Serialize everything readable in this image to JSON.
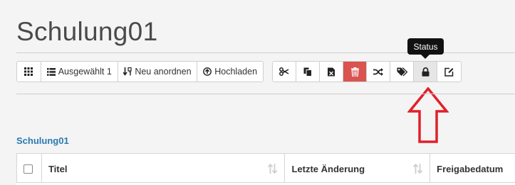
{
  "page": {
    "title": "Schulung01"
  },
  "toolbar_left": {
    "grid_icon": "grid-icon",
    "selected_label": "Ausgewählt 1",
    "reorder_label": "Neu anordnen",
    "upload_label": "Hochladen"
  },
  "toolbar_right": {
    "icons": [
      "scissors-icon",
      "copy-icon",
      "bookmark-remove-icon",
      "trash-icon",
      "shuffle-icon",
      "tags-icon",
      "lock-icon",
      "edit-icon"
    ]
  },
  "tooltip": {
    "text": "Status"
  },
  "annotation": {
    "color": "#e0202a",
    "icon": "arrow-up-outline"
  },
  "breadcrumb": {
    "label": "Schulung01"
  },
  "table": {
    "columns": [
      {
        "label": ""
      },
      {
        "label": "Titel"
      },
      {
        "label": "Letzte Änderung"
      },
      {
        "label": "Freigabedatum"
      }
    ]
  },
  "colors": {
    "danger": "#d9534f",
    "link": "#2a7ab0"
  }
}
